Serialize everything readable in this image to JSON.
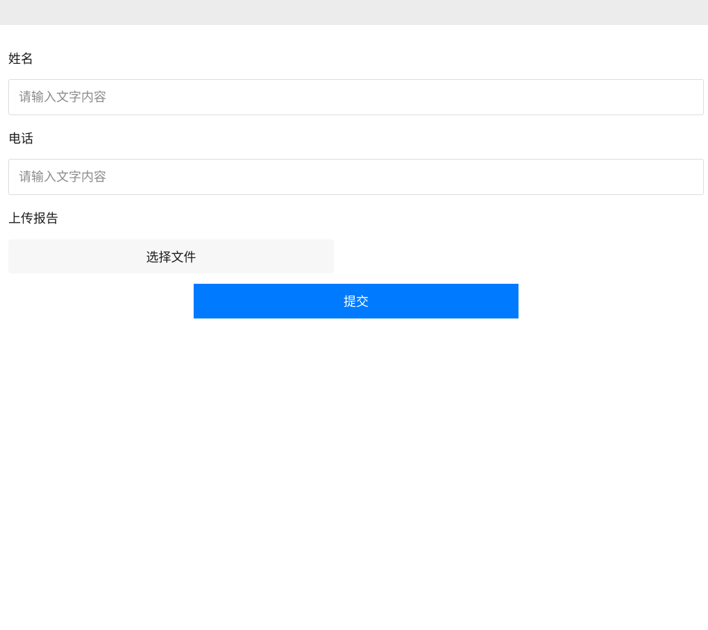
{
  "form": {
    "name": {
      "label": "姓名",
      "value": "",
      "placeholder": "请输入文字内容"
    },
    "phone": {
      "label": "电话",
      "value": "",
      "placeholder": "请输入文字内容"
    },
    "report": {
      "label": "上传报告",
      "choose_file_label": "选择文件"
    },
    "submit_label": "提交"
  },
  "colors": {
    "accent": "#007aff",
    "top_bar": "#ececec",
    "file_button_bg": "#f7f7f7"
  }
}
